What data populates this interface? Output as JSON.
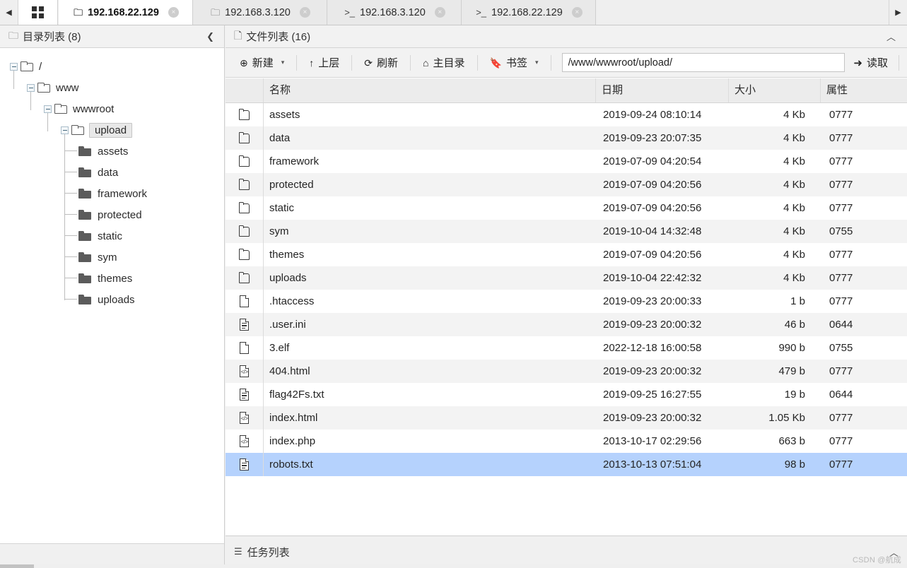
{
  "window": {
    "scroll_left_icon": "left-arrow",
    "scroll_right_icon": "right-arrow",
    "grid_icon": "grid-icon"
  },
  "tabs": [
    {
      "icon": "folder-icon",
      "label": "192.168.22.129",
      "active": true,
      "close": "×"
    },
    {
      "icon": "folder-icon",
      "label": "192.168.3.120",
      "active": false,
      "close": "×"
    },
    {
      "icon": "terminal-icon",
      "label": "192.168.3.120",
      "active": false,
      "close": "×"
    },
    {
      "icon": "terminal-icon",
      "label": "192.168.22.129",
      "active": false,
      "close": "×"
    }
  ],
  "sidebar": {
    "icon": "folder-icon",
    "title": "目录列表 (8)",
    "collapse_label": "❮",
    "tree": [
      {
        "label": "/",
        "depth": 0,
        "type": "open-folder",
        "expanded": true,
        "selected": false
      },
      {
        "label": "www",
        "depth": 1,
        "type": "open-folder",
        "expanded": true,
        "selected": false
      },
      {
        "label": "wwwroot",
        "depth": 2,
        "type": "open-folder",
        "expanded": true,
        "selected": false
      },
      {
        "label": "upload",
        "depth": 3,
        "type": "open-folder",
        "expanded": true,
        "selected": true
      },
      {
        "label": "assets",
        "depth": 4,
        "type": "leaf-folder",
        "expanded": false,
        "selected": false
      },
      {
        "label": "data",
        "depth": 4,
        "type": "leaf-folder",
        "expanded": false,
        "selected": false
      },
      {
        "label": "framework",
        "depth": 4,
        "type": "leaf-folder",
        "expanded": false,
        "selected": false
      },
      {
        "label": "protected",
        "depth": 4,
        "type": "leaf-folder",
        "expanded": false,
        "selected": false
      },
      {
        "label": "static",
        "depth": 4,
        "type": "leaf-folder",
        "expanded": false,
        "selected": false
      },
      {
        "label": "sym",
        "depth": 4,
        "type": "leaf-folder",
        "expanded": false,
        "selected": false
      },
      {
        "label": "themes",
        "depth": 4,
        "type": "leaf-folder",
        "expanded": false,
        "selected": false
      },
      {
        "label": "uploads",
        "depth": 4,
        "type": "leaf-folder",
        "expanded": false,
        "selected": false
      }
    ]
  },
  "filepanel": {
    "icon": "file-icon",
    "title": "文件列表 (16)",
    "collapse_label": "︿",
    "toolbar": {
      "new_label": "新建",
      "new_icon": "plus-circle-icon",
      "up_label": "上层",
      "up_icon": "arrow-up-icon",
      "refresh_label": "刷新",
      "refresh_icon": "refresh-icon",
      "home_label": "主目录",
      "home_icon": "home-icon",
      "bookmark_label": "书签",
      "bookmark_icon": "bookmark-icon",
      "caret": "▾",
      "path_value": "/www/wwwroot/upload/",
      "path_placeholder": "/www/wwwroot/",
      "go_label": "读取",
      "go_icon": "arrow-right-icon"
    },
    "columns": [
      "",
      "名称",
      "日期",
      "大小",
      "属性"
    ],
    "rows": [
      {
        "icon": "folder-icon",
        "name": "assets",
        "date": "2019-09-24 08:10:14",
        "size": "4 Kb",
        "attr": "0777",
        "selected": false
      },
      {
        "icon": "folder-icon",
        "name": "data",
        "date": "2019-09-23 20:07:35",
        "size": "4 Kb",
        "attr": "0777",
        "selected": false
      },
      {
        "icon": "folder-icon",
        "name": "framework",
        "date": "2019-07-09 04:20:54",
        "size": "4 Kb",
        "attr": "0777",
        "selected": false
      },
      {
        "icon": "folder-icon",
        "name": "protected",
        "date": "2019-07-09 04:20:56",
        "size": "4 Kb",
        "attr": "0777",
        "selected": false
      },
      {
        "icon": "folder-icon",
        "name": "static",
        "date": "2019-07-09 04:20:56",
        "size": "4 Kb",
        "attr": "0777",
        "selected": false
      },
      {
        "icon": "folder-icon",
        "name": "sym",
        "date": "2019-10-04 14:32:48",
        "size": "4 Kb",
        "attr": "0755",
        "selected": false
      },
      {
        "icon": "folder-icon",
        "name": "themes",
        "date": "2019-07-09 04:20:56",
        "size": "4 Kb",
        "attr": "0777",
        "selected": false
      },
      {
        "icon": "folder-icon",
        "name": "uploads",
        "date": "2019-10-04 22:42:32",
        "size": "4 Kb",
        "attr": "0777",
        "selected": false
      },
      {
        "icon": "blank-file-icon",
        "name": ".htaccess",
        "date": "2019-09-23 20:00:33",
        "size": "1 b",
        "attr": "0777",
        "selected": false
      },
      {
        "icon": "text-file-icon",
        "name": ".user.ini",
        "date": "2019-09-23 20:00:32",
        "size": "46 b",
        "attr": "0644",
        "selected": false
      },
      {
        "icon": "blank-file-icon",
        "name": "3.elf",
        "date": "2022-12-18 16:00:58",
        "size": "990 b",
        "attr": "0755",
        "selected": false
      },
      {
        "icon": "code-file-icon",
        "name": "404.html",
        "date": "2019-09-23 20:00:32",
        "size": "479 b",
        "attr": "0777",
        "selected": false
      },
      {
        "icon": "text-file-icon",
        "name": "flag42Fs.txt",
        "date": "2019-09-25 16:27:55",
        "size": "19 b",
        "attr": "0644",
        "selected": false
      },
      {
        "icon": "code-file-icon",
        "name": "index.html",
        "date": "2019-09-23 20:00:32",
        "size": "1.05 Kb",
        "attr": "0777",
        "selected": false
      },
      {
        "icon": "code-file-icon",
        "name": "index.php",
        "date": "2013-10-17 02:29:56",
        "size": "663 b",
        "attr": "0777",
        "selected": false
      },
      {
        "icon": "text-file-icon",
        "name": "robots.txt",
        "date": "2013-10-13 07:51:04",
        "size": "98 b",
        "attr": "0777",
        "selected": true
      }
    ]
  },
  "taskbar": {
    "icon": "list-icon",
    "title": "任务列表",
    "collapse_label": "︿"
  },
  "watermark": "CSDN @航成",
  "colors": {
    "selection": "#b5d2fd",
    "alt_row": "#f3f3f3",
    "chrome": "#f0f0f0",
    "header": "#ececec",
    "border": "#d4d4d4"
  }
}
